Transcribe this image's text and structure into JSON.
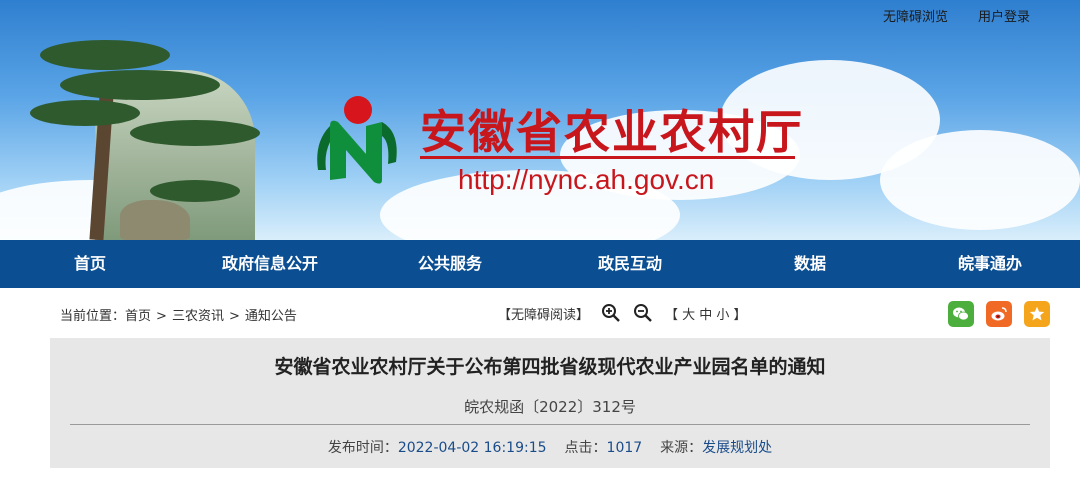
{
  "header": {
    "top_links": [
      "无障碍浏览",
      "用户登录"
    ],
    "site_title": "安徽省农业农村厅",
    "site_url": "http://nync.ah.gov.cn"
  },
  "nav": {
    "items": [
      "首页",
      "政府信息公开",
      "公共服务",
      "政民互动",
      "数据",
      "皖事通办"
    ]
  },
  "breadcrumb": {
    "prefix": "当前位置：",
    "items": [
      "首页",
      "三农资讯",
      "通知公告"
    ],
    "separator": ">"
  },
  "tools": {
    "accessible_read": "【无障碍阅读】",
    "font_size_label": "【 大 中 小 】"
  },
  "share": {
    "icons": [
      "wechat-icon",
      "weibo-icon",
      "favorite-icon"
    ],
    "colors": {
      "wechat": "#4cae3c",
      "weibo": "#f06a26",
      "favorite": "#f4a51c"
    }
  },
  "article": {
    "title": "安徽省农业农村厅关于公布第四批省级现代农业产业园名单的通知",
    "doc_number": "皖农规函〔2022〕312号",
    "publish_label": "发布时间：",
    "publish_time": "2022-04-02 16:19:15",
    "hits_label": "点击：",
    "hits": "1017",
    "source_label": "来源：",
    "source": "发展规划处"
  },
  "colors": {
    "brand_red": "#c8161d",
    "nav_blue": "#0b4f92",
    "meta_blue": "#1a4c8a"
  }
}
